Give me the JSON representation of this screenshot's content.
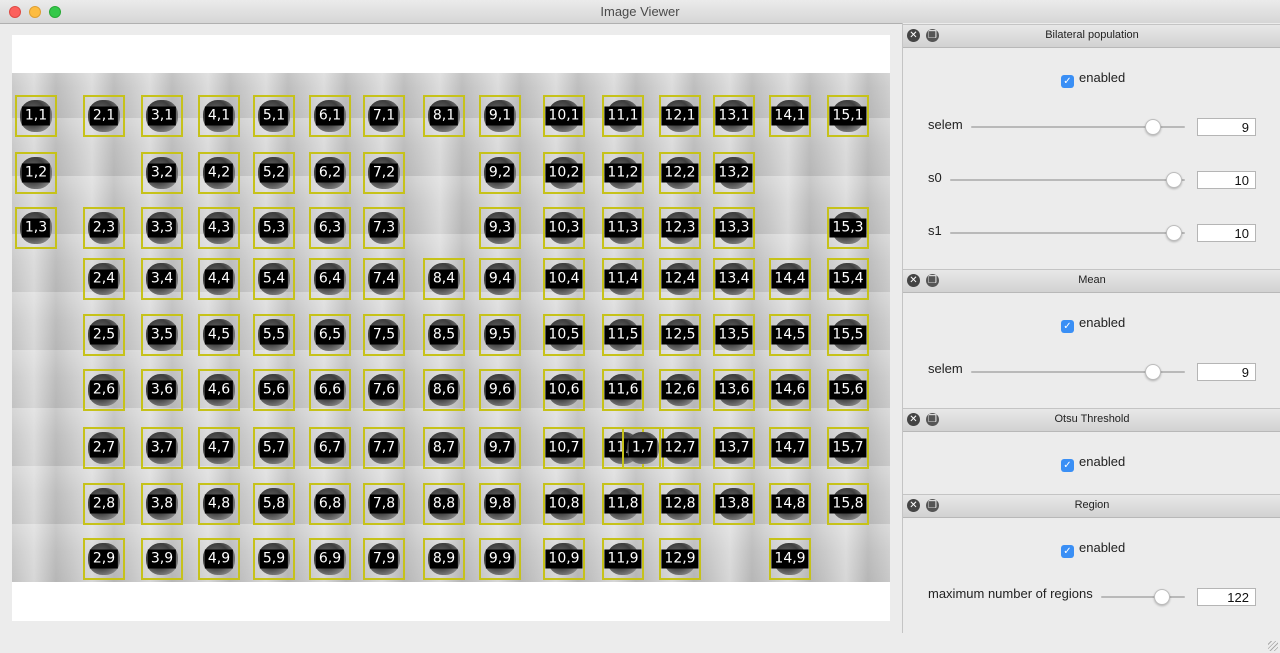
{
  "window": {
    "title": "Image Viewer"
  },
  "colonies": [
    [
      "1,1",
      "1,2",
      "1,3"
    ],
    [
      "2,1",
      "2,3",
      "2,4",
      "2,5",
      "2,6",
      "2,7",
      "2,8",
      "2,9"
    ],
    [
      "3,1",
      "3,2",
      "3,3",
      "3,4",
      "3,5",
      "3,6",
      "3,7",
      "3,8",
      "3,9"
    ],
    [
      "4,1",
      "4,2",
      "4,3",
      "4,4",
      "4,5",
      "4,6",
      "4,7",
      "4,8",
      "4,9"
    ],
    [
      "5,1",
      "5,2",
      "5,3",
      "5,4",
      "5,5",
      "5,6",
      "5,7",
      "5,8",
      "5,9"
    ],
    [
      "6,1",
      "6,2",
      "6,3",
      "6,4",
      "6,5",
      "6,6",
      "6,7",
      "6,8",
      "6,9"
    ],
    [
      "7,1",
      "7,2",
      "7,3",
      "7,4",
      "7,5",
      "7,6",
      "7,7",
      "7,8",
      "7,9"
    ],
    [
      "8,1",
      "8,4",
      "8,5",
      "8,6",
      "8,7",
      "8,8",
      "8,9"
    ],
    [
      "9,1",
      "9,2",
      "9,3",
      "9,4",
      "9,5",
      "9,6",
      "9,7",
      "9,8",
      "9,9"
    ],
    [
      "10,1",
      "10,2",
      "10,3",
      "10,4",
      "10,5",
      "10,6",
      "10,7",
      "10,8",
      "10,9"
    ],
    [
      "11,1",
      "11,2",
      "11,3",
      "11,4",
      "11,5",
      "11,6",
      "11,7",
      "1,7",
      "11,8",
      "11,9"
    ],
    [
      "12,1",
      "12,2",
      "12,3",
      "12,4",
      "12,5",
      "12,6",
      "12,7",
      "12,8",
      "12,9"
    ],
    [
      "13,1",
      "13,2",
      "13,3",
      "13,4",
      "13,5",
      "13,6",
      "13,7",
      "13,8"
    ],
    [
      "14,1",
      "14,4",
      "14,5",
      "14,6",
      "14,7",
      "14,8",
      "14,9"
    ],
    [
      "15,1",
      "15,3",
      "15,4",
      "15,5",
      "15,6",
      "15,7",
      "15,8"
    ]
  ],
  "panels": {
    "bilateral": {
      "title": "Bilateral population",
      "enabled_label": "enabled",
      "params": [
        {
          "label": "selem",
          "value": "9",
          "level": 0.86
        },
        {
          "label": "s0",
          "value": "10",
          "level": 1.0
        },
        {
          "label": "s1",
          "value": "10",
          "level": 1.0
        }
      ]
    },
    "mean": {
      "title": "Mean",
      "enabled_label": "enabled",
      "params": [
        {
          "label": "selem",
          "value": "9",
          "level": 0.86
        }
      ]
    },
    "otsu": {
      "title": "Otsu Threshold",
      "enabled_label": "enabled"
    },
    "region": {
      "title": "Region",
      "enabled_label": "enabled",
      "params": [
        {
          "label": "maximum number of regions",
          "value": "122",
          "level": 0.72
        }
      ]
    }
  },
  "icons": {
    "close": "close-circle-icon",
    "float": "float-window-icon",
    "check": "checkmark-icon"
  }
}
